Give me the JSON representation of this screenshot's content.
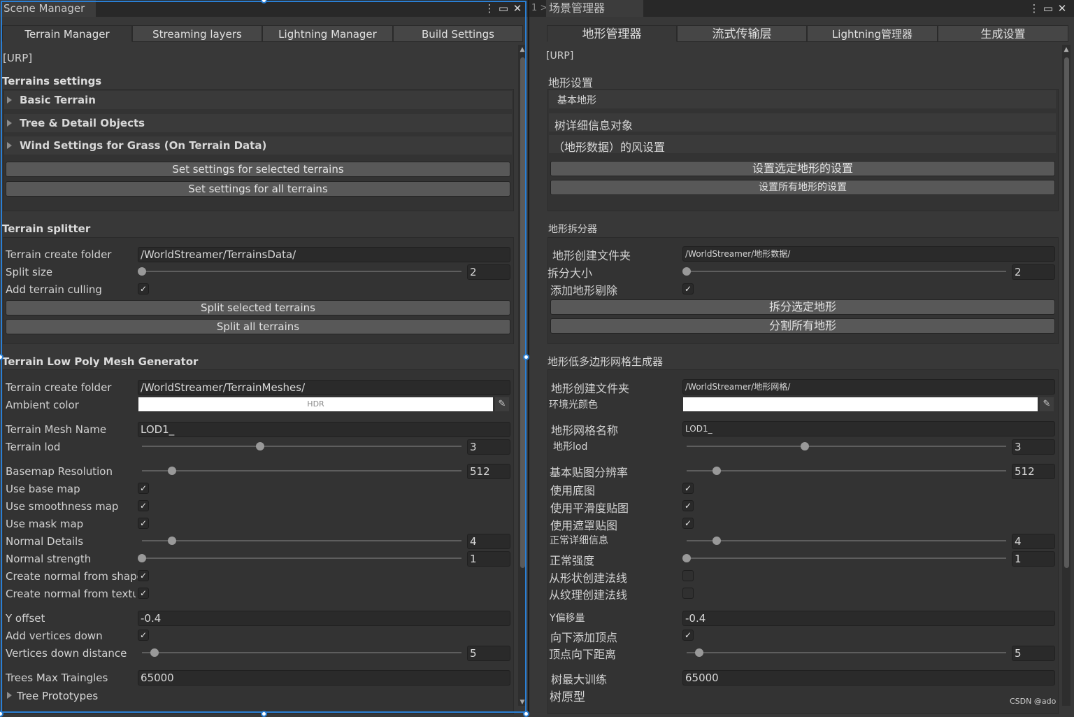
{
  "left": {
    "window_title": "Scene Manager",
    "tabs": [
      "Terrain Manager",
      "Streaming layers",
      "Lightning Manager",
      "Build Settings"
    ],
    "pipeline": "[URP]",
    "terrains_settings": {
      "header": "Terrains settings",
      "foldouts": [
        "Basic Terrain",
        "Tree & Detail Objects",
        "Wind Settings for Grass (On Terrain Data)"
      ],
      "btn_selected": "Set settings for selected terrains",
      "btn_all": "Set settings for all terrains"
    },
    "splitter": {
      "header": "Terrain splitter",
      "folder_label": "Terrain create folder",
      "folder_value": "/WorldStreamer/TerrainsData/",
      "split_label": "Split size",
      "split_value": "2",
      "culling_label": "Add terrain culling",
      "btn_selected": "Split selected terrains",
      "btn_all": "Split all terrains"
    },
    "lowpoly": {
      "header": "Terrain Low Poly Mesh Generator",
      "folder_label": "Terrain create folder",
      "folder_value": "/WorldStreamer/TerrainMeshes/",
      "ambient_label": "Ambient color",
      "hdr": "HDR",
      "mesh_name_label": "Terrain Mesh Name",
      "mesh_name_value": "LOD1_",
      "lod_label": "Terrain lod",
      "lod_value": "3",
      "basemap_label": "Basemap Resolution",
      "basemap_value": "512",
      "use_base_label": "Use base map",
      "use_smooth_label": "Use smoothness map",
      "use_mask_label": "Use mask map",
      "normal_details_label": "Normal Details",
      "normal_details_value": "4",
      "normal_strength_label": "Normal strength",
      "normal_strength_value": "1",
      "normal_shape_label": "Create normal from shape",
      "normal_texture_label": "Create normal from texture",
      "y_offset_label": "Y offset",
      "y_offset_value": "-0.4",
      "add_vertices_label": "Add vertices down",
      "vertices_dist_label": "Vertices down distance",
      "vertices_dist_value": "5",
      "trees_max_label": "Trees Max Traingles",
      "trees_max_value": "65000",
      "tree_proto_label": "Tree Prototypes"
    }
  },
  "right": {
    "lead_fragment": "1 >",
    "window_title": "场景管理器",
    "tabs": [
      "地形管理器",
      "流式传输层",
      "Lightning管理器",
      "生成设置"
    ],
    "pipeline": "[URP]",
    "terrains_settings": {
      "header": "地形设置",
      "foldouts": [
        "基本地形",
        "树详细信息对象",
        "（地形数据）的风设置"
      ],
      "btn_selected": "设置选定地形的设置",
      "btn_all": "设置所有地形的设置"
    },
    "splitter": {
      "header": "地形拆分器",
      "folder_label": "地形创建文件夹",
      "folder_value": "/WorldStreamer/地形数据/",
      "split_label": "拆分大小",
      "split_value": "2",
      "culling_label": "添加地形剔除",
      "btn_selected": "拆分选定地形",
      "btn_all": "分割所有地形"
    },
    "lowpoly": {
      "header": "地形低多边形网格生成器",
      "folder_label": "地形创建文件夹",
      "folder_value": "/WorldStreamer/地形网格/",
      "ambient_label": "环境光颜色",
      "mesh_name_label": "地形网格名称",
      "mesh_name_value": "LOD1_",
      "lod_label": "地形lod",
      "lod_value": "3",
      "basemap_label": "基本贴图分辨率",
      "basemap_value": "512",
      "use_base_label": "使用底图",
      "use_smooth_label": "使用平滑度贴图",
      "use_mask_label": "使用遮罩贴图",
      "normal_details_label": "正常详细信息",
      "normal_details_value": "4",
      "normal_strength_label": "正常强度",
      "normal_strength_value": "1",
      "normal_shape_label": "从形状创建法线",
      "normal_texture_label": "从纹理创建法线",
      "y_offset_label": "Y偏移量",
      "y_offset_value": "-0.4",
      "add_vertices_label": "向下添加顶点",
      "vertices_dist_label": "顶点向下距离",
      "vertices_dist_value": "5",
      "trees_max_label": "树最大训练",
      "trees_max_value": "65000",
      "tree_proto_label": "树原型"
    }
  },
  "watermark": "CSDN @ado",
  "colors": {
    "accent": "#2a7fd4",
    "background": "#383838",
    "button": "#585858",
    "field": "#2a2a2a"
  }
}
